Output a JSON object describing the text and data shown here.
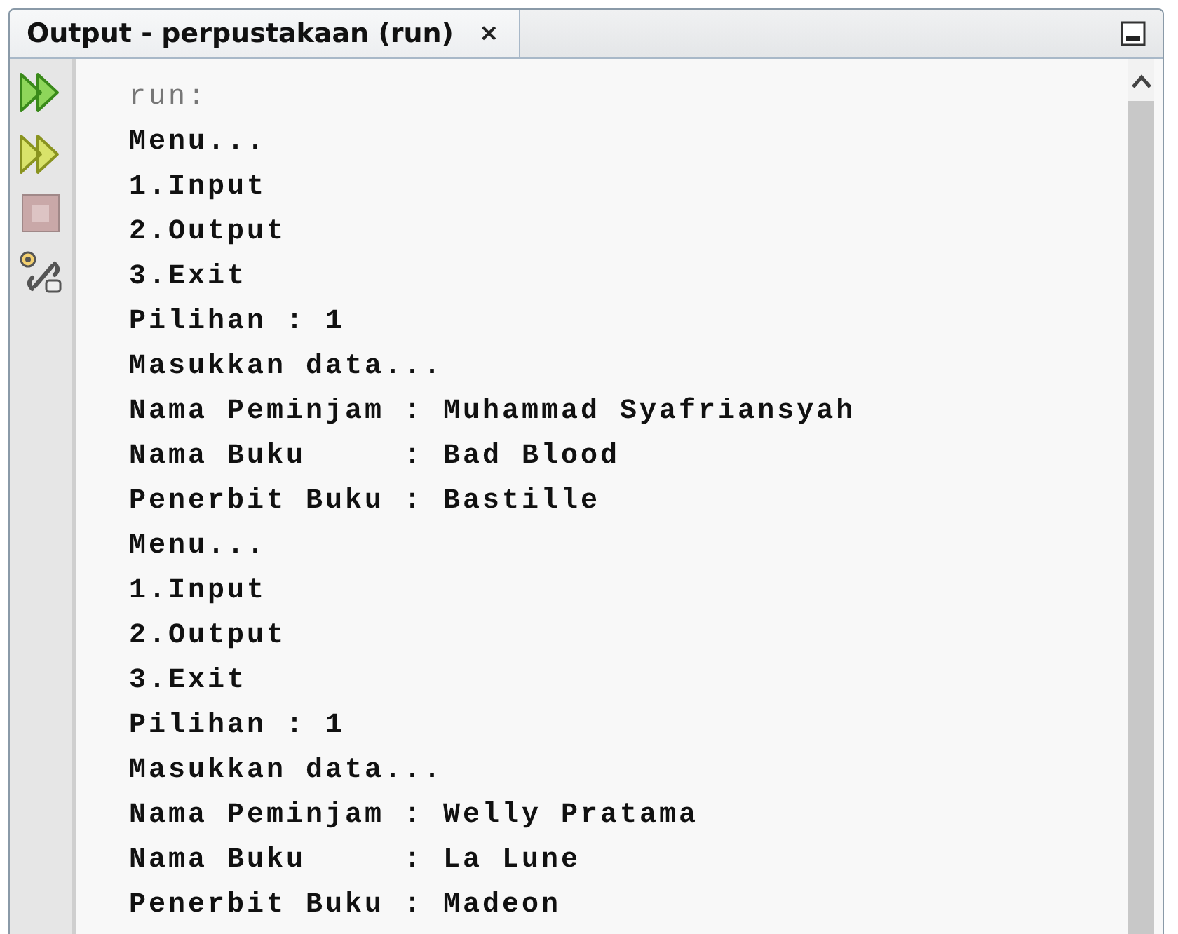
{
  "tab": {
    "title": "Output - perpustakaan (run)",
    "close": "×",
    "selected": true
  },
  "toolbar": [
    {
      "kind": "rerun"
    },
    {
      "kind": "rerun-alt"
    },
    {
      "kind": "stop",
      "disabled": true
    },
    {
      "kind": "settings"
    }
  ],
  "output": {
    "lines": [
      {
        "kind": "system",
        "text": "run:"
      },
      {
        "kind": "out",
        "text": "Menu..."
      },
      {
        "kind": "out",
        "text": "1.Input"
      },
      {
        "kind": "out",
        "text": "2.Output"
      },
      {
        "kind": "out",
        "text": "3.Exit"
      },
      {
        "kind": "out",
        "text": "Pilihan : 1"
      },
      {
        "kind": "out",
        "text": "Masukkan data..."
      },
      {
        "kind": "out",
        "text": "Nama Peminjam : Muhammad Syafriansyah"
      },
      {
        "kind": "out",
        "text": "Nama Buku     : Bad Blood"
      },
      {
        "kind": "out",
        "text": "Penerbit Buku : Bastille"
      },
      {
        "kind": "out",
        "text": "Menu..."
      },
      {
        "kind": "out",
        "text": "1.Input"
      },
      {
        "kind": "out",
        "text": "2.Output"
      },
      {
        "kind": "out",
        "text": "3.Exit"
      },
      {
        "kind": "out",
        "text": "Pilihan : 1"
      },
      {
        "kind": "out",
        "text": "Masukkan data..."
      },
      {
        "kind": "out",
        "text": "Nama Peminjam : Welly Pratama"
      },
      {
        "kind": "out",
        "text": "Nama Buku     : La Lune"
      },
      {
        "kind": "out",
        "text": "Penerbit Buku : Madeon"
      }
    ]
  }
}
